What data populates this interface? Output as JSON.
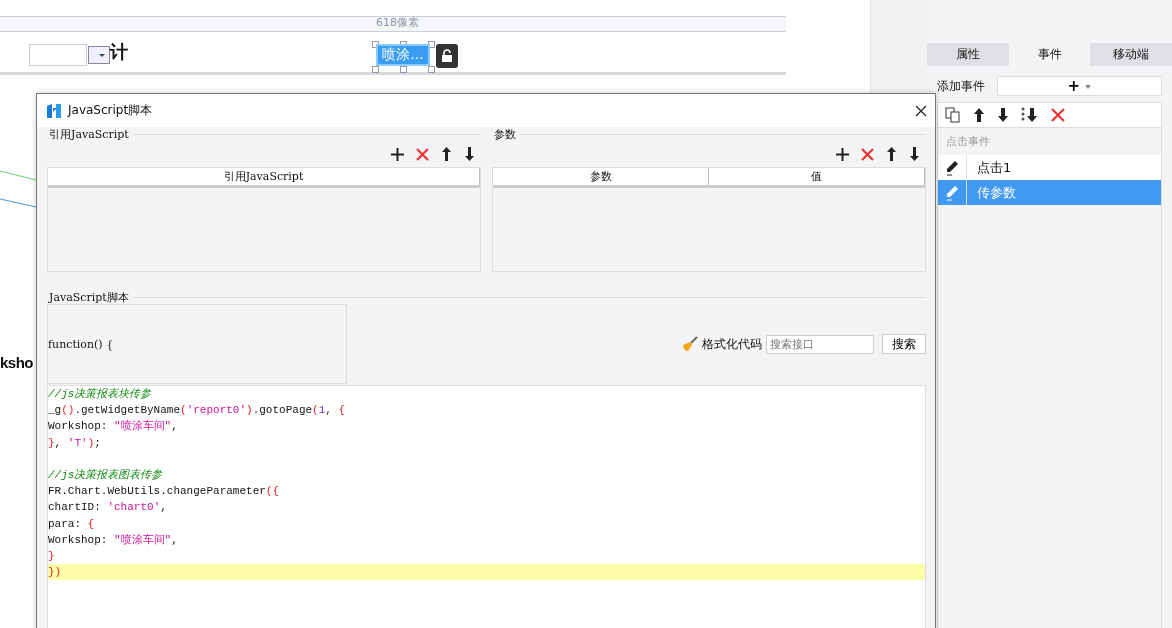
{
  "canvas": {
    "ruler_label": "618像素",
    "cut_text_top": "计",
    "cut_text_bottom": "ksho",
    "widget_button": "喷涂..."
  },
  "side_panel": {
    "tabs": [
      {
        "label": "属性",
        "selected": false
      },
      {
        "label": "事件",
        "selected": true
      },
      {
        "label": "移动端",
        "selected": false
      }
    ],
    "add_event_label": "添加事件",
    "add_event_button": "+",
    "section": "点击事件",
    "events": [
      {
        "label": "点击1",
        "selected": false
      },
      {
        "label": "传参数",
        "selected": true
      }
    ]
  },
  "dialog": {
    "title": "JavaScript脚本",
    "refs": {
      "heading": "引用JavaScript",
      "columns": [
        "引用JavaScript"
      ]
    },
    "params": {
      "heading": "参数",
      "columns": [
        "参数",
        "值"
      ]
    },
    "script": {
      "heading": "JavaScript脚本",
      "signature": "function() {",
      "format_label": "格式化代码",
      "search_placeholder": "搜索接口",
      "search_button": "搜索",
      "lines": [
        {
          "highlighted": false,
          "tokens": [
            {
              "t": "//js决策报表块传参",
              "kind": "comment"
            }
          ]
        },
        {
          "highlighted": false,
          "tokens": [
            {
              "t": "_g",
              "kind": "plain"
            },
            {
              "t": "()",
              "kind": "bracket"
            },
            {
              "t": ".getWidgetByName",
              "kind": "plain"
            },
            {
              "t": "(",
              "kind": "bracket"
            },
            {
              "t": "'report0'",
              "kind": "string"
            },
            {
              "t": ")",
              "kind": "bracket"
            },
            {
              "t": ".gotoPage",
              "kind": "plain"
            },
            {
              "t": "(",
              "kind": "bracket"
            },
            {
              "t": "1",
              "kind": "number"
            },
            {
              "t": ", ",
              "kind": "plain"
            },
            {
              "t": "{",
              "kind": "bracket"
            }
          ]
        },
        {
          "highlighted": false,
          "tokens": [
            {
              "t": "Workshop: ",
              "kind": "plain"
            },
            {
              "t": "\"喷涂车间\"",
              "kind": "string"
            },
            {
              "t": ",",
              "kind": "plain"
            }
          ]
        },
        {
          "highlighted": false,
          "tokens": [
            {
              "t": "}",
              "kind": "bracket"
            },
            {
              "t": ", ",
              "kind": "plain"
            },
            {
              "t": "'T'",
              "kind": "string"
            },
            {
              "t": ")",
              "kind": "bracket"
            },
            {
              "t": ";",
              "kind": "plain"
            }
          ]
        },
        {
          "highlighted": false
        },
        {
          "highlighted": false,
          "tokens": [
            {
              "t": "//js决策报表图表传参",
              "kind": "comment"
            }
          ]
        },
        {
          "highlighted": false,
          "tokens": [
            {
              "t": "FR.Chart.WebUtils.changeParameter",
              "kind": "plain"
            },
            {
              "t": "({",
              "kind": "bracket"
            }
          ]
        },
        {
          "highlighted": false,
          "tokens": [
            {
              "t": "chartID: ",
              "kind": "plain"
            },
            {
              "t": "'chart0'",
              "kind": "string"
            },
            {
              "t": ",",
              "kind": "plain"
            }
          ]
        },
        {
          "highlighted": false,
          "tokens": [
            {
              "t": "para: ",
              "kind": "plain"
            },
            {
              "t": "{",
              "kind": "bracket"
            }
          ]
        },
        {
          "highlighted": false,
          "tokens": [
            {
              "t": "Workshop: ",
              "kind": "plain"
            },
            {
              "t": "\"喷涂车间\"",
              "kind": "string"
            },
            {
              "t": ",",
              "kind": "plain"
            }
          ]
        },
        {
          "highlighted": false,
          "tokens": [
            {
              "t": "}",
              "kind": "bracket"
            }
          ]
        },
        {
          "highlighted": true,
          "tokens": [
            {
              "t": "})",
              "kind": "bracket"
            }
          ]
        }
      ]
    }
  }
}
